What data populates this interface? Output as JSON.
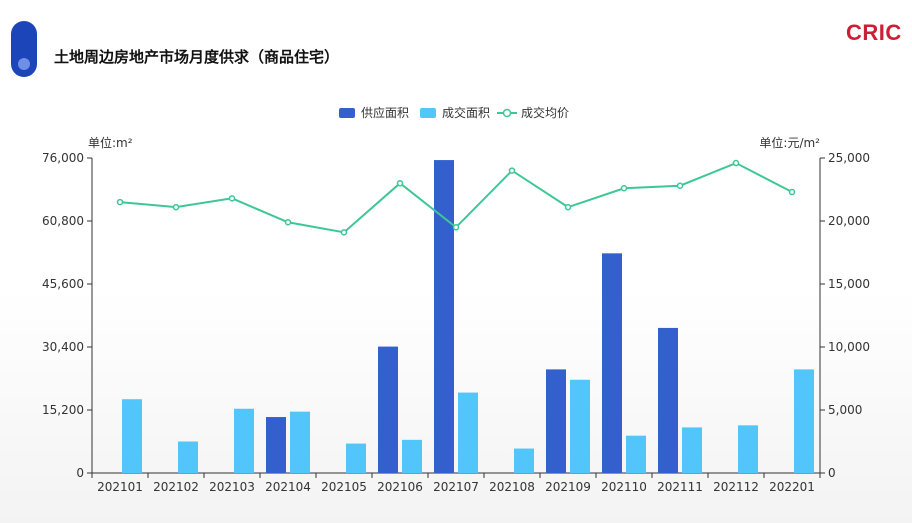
{
  "header": {
    "title": "土地周边房地产市场月度供求（商品住宅）",
    "logo": "CRIC"
  },
  "colors": {
    "supply": "#3360cc",
    "deal": "#52c6fa",
    "price": "#3ec796",
    "brand": "#cc1f36",
    "pill": "#1b45b8"
  },
  "chart_data": {
    "type": "bar",
    "categories": [
      "202101",
      "202102",
      "202103",
      "202104",
      "202105",
      "202106",
      "202107",
      "202108",
      "202109",
      "202110",
      "202111",
      "202112",
      "202201"
    ],
    "series": [
      {
        "name": "供应面积",
        "kind": "bar",
        "axis": "left",
        "values": [
          0,
          0,
          0,
          13500,
          0,
          30500,
          75500,
          0,
          25000,
          53000,
          35000,
          0,
          0
        ]
      },
      {
        "name": "成交面积",
        "kind": "bar",
        "axis": "left",
        "values": [
          17800,
          7600,
          15500,
          14800,
          7100,
          8000,
          19400,
          5900,
          22500,
          9000,
          11000,
          11500,
          25000
        ]
      },
      {
        "name": "成交均价",
        "kind": "line",
        "axis": "right",
        "values": [
          21500,
          21100,
          21800,
          19900,
          19100,
          23000,
          19500,
          24000,
          21100,
          22600,
          22800,
          24600,
          22300
        ]
      }
    ],
    "y_left": {
      "label": "单位:m²",
      "min": 0,
      "max": 76000,
      "ticks": [
        "0",
        "15,200",
        "30,400",
        "45,600",
        "60,800",
        "76,000"
      ]
    },
    "y_right": {
      "label": "单位:元/m²",
      "min": 0,
      "max": 25000,
      "ticks": [
        "0",
        "5,000",
        "10,000",
        "15,000",
        "20,000",
        "25,000"
      ]
    },
    "legend_position": "top-center",
    "grid": false
  }
}
